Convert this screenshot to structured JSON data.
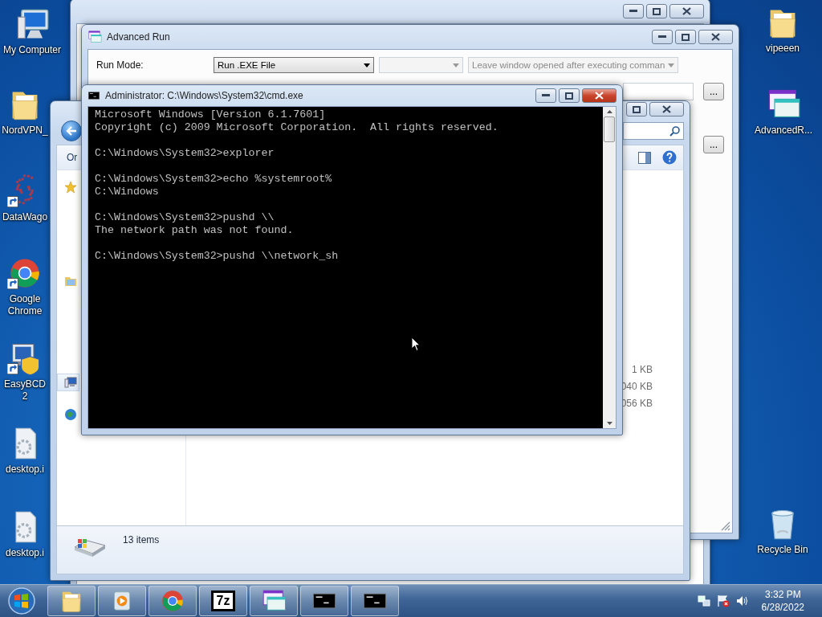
{
  "desktop_icons": [
    {
      "label": "My Computer",
      "kind": "computer",
      "shortcut": false
    },
    {
      "label": "NordVPN_",
      "kind": "folder",
      "shortcut": false
    },
    {
      "label": "DataWago",
      "kind": "dots",
      "shortcut": true
    },
    {
      "label": "Google Chrome",
      "kind": "browser",
      "shortcut": true
    },
    {
      "label": "EasyBCD 2",
      "kind": "monitor-shield",
      "shortcut": true
    },
    {
      "label": "desktop.i",
      "kind": "settings-file",
      "shortcut": false
    },
    {
      "label": "desktop.i",
      "kind": "settings-file",
      "shortcut": false
    },
    {
      "label": "vipeeen",
      "kind": "folder",
      "shortcut": false
    },
    {
      "label": "AdvancedR...",
      "kind": "app-windows",
      "shortcut": false
    },
    {
      "label": "Recycle Bin",
      "kind": "bin",
      "shortcut": false
    }
  ],
  "back_window": {
    "active": false
  },
  "advanced_run": {
    "title": "Advanced Run",
    "active": false,
    "run_mode_label": "Run Mode:",
    "selects": [
      {
        "value": "Run .EXE File",
        "disabled": false
      },
      {
        "disabled": true
      },
      {
        "value": "Leave window opened after executing comman",
        "disabled": true
      }
    ],
    "browse_buttons": [
      "...",
      "..."
    ]
  },
  "explorer": {
    "active": false,
    "toolbar_label": "Or",
    "nav_items": [
      {
        "kind": "favorites",
        "selected": false
      },
      {
        "kind": "libraries",
        "selected": false
      },
      {
        "kind": "computer",
        "selected": true
      },
      {
        "kind": "network",
        "selected": false
      }
    ],
    "sizes": [
      "1 KB",
      "040 KB",
      "056 KB"
    ],
    "status": "13 items"
  },
  "cmd": {
    "title": "Administrator: C:\\Windows\\System32\\cmd.exe",
    "active": true,
    "paragraphs": [
      [
        "Microsoft Windows [Version 6.1.7601]",
        "Copyright (c) 2009 Microsoft Corporation.  All rights reserved."
      ],
      [
        "C:\\Windows\\System32>explorer"
      ],
      [
        "C:\\Windows\\System32>echo %systemroot%",
        "C:\\Windows"
      ],
      [
        "C:\\Windows\\System32>pushd \\\\",
        "The network path was not found."
      ],
      [
        "C:\\Windows\\System32>pushd \\\\network_sh"
      ]
    ]
  },
  "taskbar": {
    "items": [
      {
        "kind": "explorer"
      },
      {
        "kind": "media"
      },
      {
        "kind": "browser"
      },
      {
        "kind": "archive",
        "glyph": "7z"
      },
      {
        "kind": "app-windows"
      },
      {
        "kind": "console"
      },
      {
        "kind": "console"
      }
    ],
    "time": "3:32 PM",
    "date": "6/28/2022"
  }
}
